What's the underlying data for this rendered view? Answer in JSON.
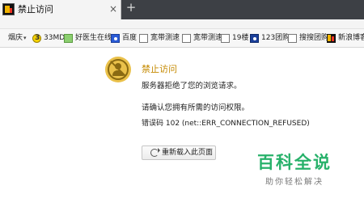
{
  "tab": {
    "title": "禁止访问",
    "close_glyph": "×",
    "new_tab_glyph": "+"
  },
  "bookmarks": {
    "city": "烟庆",
    "city_caret": "▾",
    "items": [
      {
        "label": "33MD",
        "icon": "33md-icon"
      },
      {
        "label": "好医生在线",
        "icon": "doctor-icon"
      },
      {
        "label": "百度",
        "icon": "baidu-icon"
      },
      {
        "label": "宽带测速",
        "icon": "page-icon"
      },
      {
        "label": "宽带测速",
        "icon": "page-icon"
      },
      {
        "label": "19楼",
        "icon": "page-icon"
      },
      {
        "label": "123团购",
        "icon": "tuan-icon"
      },
      {
        "label": "搜搜团购",
        "icon": "page-icon"
      },
      {
        "label": "新浪博客",
        "icon": "sina-icon"
      }
    ]
  },
  "error": {
    "title": "禁止访问",
    "description": "服务器拒绝了您的浏览请求。",
    "hint": "请确认您拥有所需的访问权限。",
    "code": "错误码 102 (net::ERR_CONNECTION_REFUSED)",
    "reload_label": "重新载入此页面"
  },
  "watermark": {
    "main": "百科全说",
    "sub": "助你轻松解决"
  },
  "colors": {
    "tabstrip": "#3d4045",
    "error_title": "#c58a00",
    "warning_icon": "#eac14a",
    "watermark_green": "#27b16a"
  }
}
